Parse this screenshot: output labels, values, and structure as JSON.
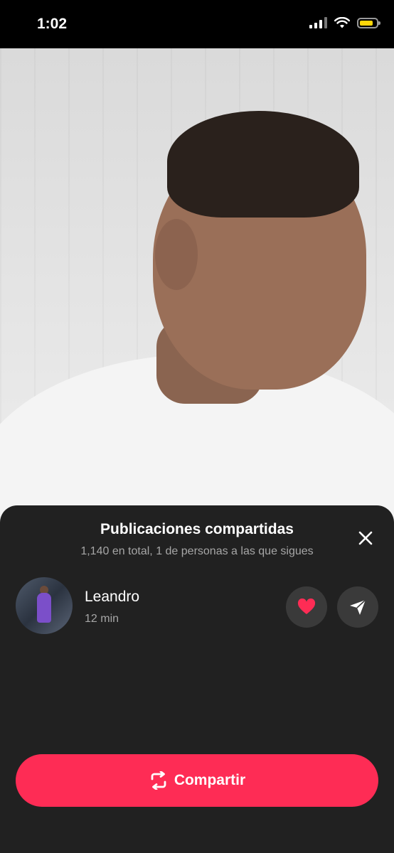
{
  "status_bar": {
    "time": "1:02",
    "battery_level": 0.8,
    "battery_color": "#ffd60a"
  },
  "sheet": {
    "title": "Publicaciones compartidas",
    "subtitle": "1,140 en total, 1 de personas a las que sigues",
    "close_icon": "close-icon"
  },
  "shared_by": [
    {
      "name": "Leandro",
      "time": "12 min",
      "actions": [
        "heart-icon",
        "send-icon"
      ]
    }
  ],
  "share_button": {
    "label": "Compartir",
    "icon": "repost-icon",
    "color": "#fe2c55"
  }
}
